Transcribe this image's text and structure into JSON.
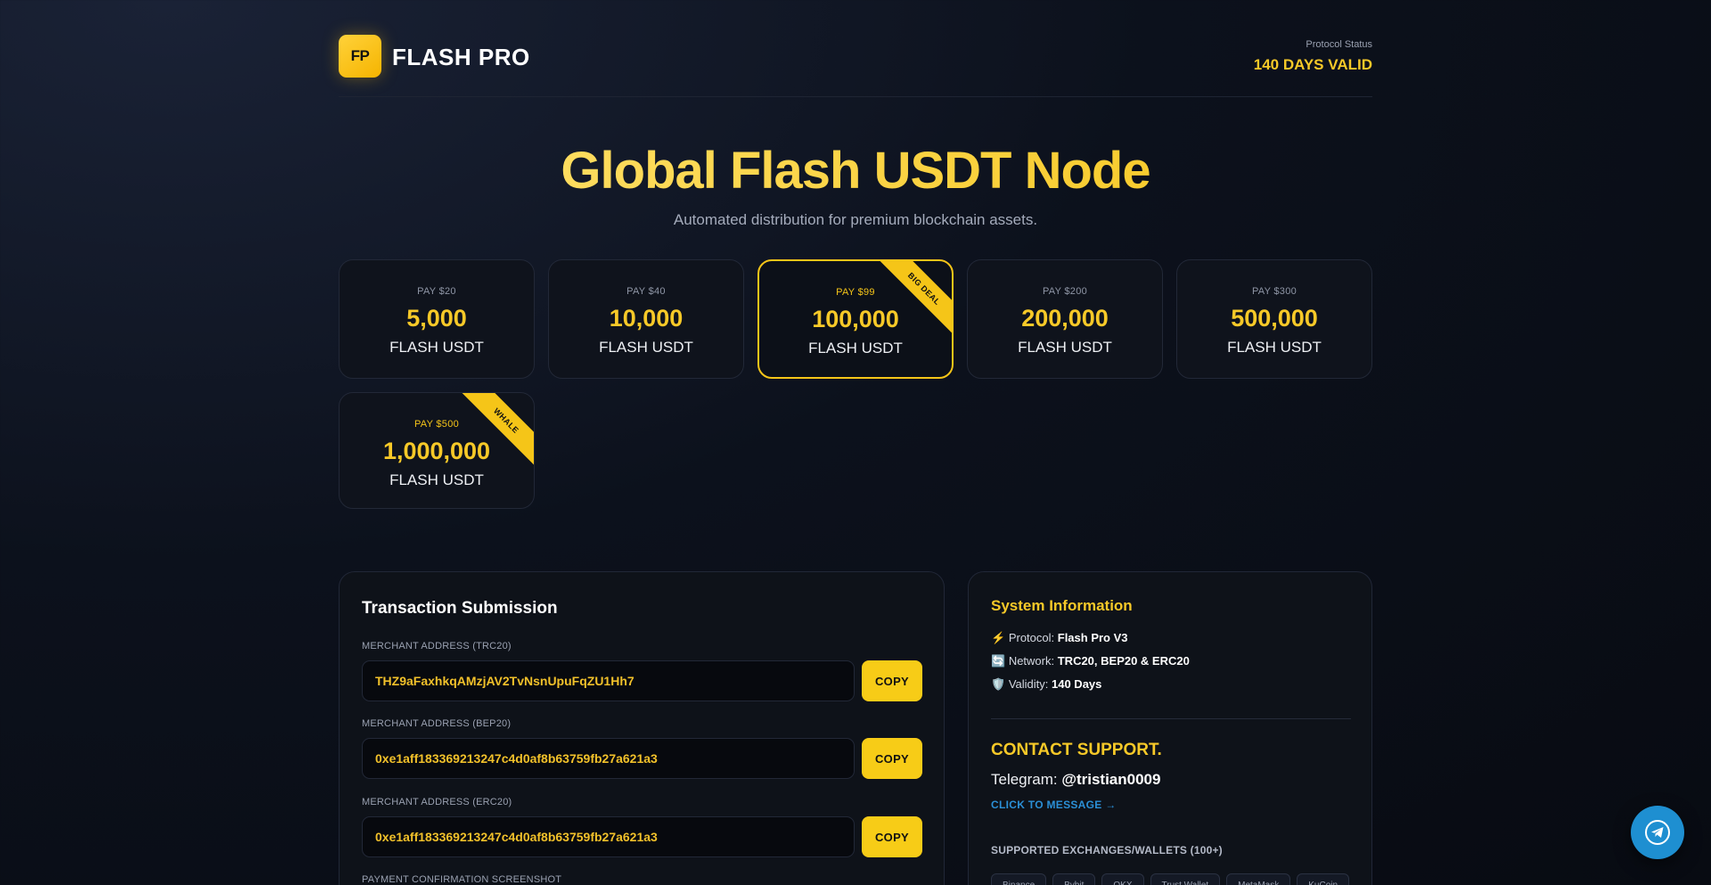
{
  "header": {
    "logo_text": "FP",
    "brand": "FLASH PRO",
    "status_label": "Protocol Status",
    "status_value": "140 DAYS VALID"
  },
  "hero": {
    "title": "Global Flash USDT Node",
    "subtitle": "Automated distribution for premium blockchain assets."
  },
  "packages": [
    {
      "pay": "PAY $20",
      "amount": "5,000",
      "unit": "FLASH USDT",
      "ribbon": ""
    },
    {
      "pay": "PAY $40",
      "amount": "10,000",
      "unit": "FLASH USDT",
      "ribbon": ""
    },
    {
      "pay": "PAY $99",
      "amount": "100,000",
      "unit": "FLASH USDT",
      "ribbon": "BIG DEAL"
    },
    {
      "pay": "PAY $200",
      "amount": "200,000",
      "unit": "FLASH USDT",
      "ribbon": ""
    },
    {
      "pay": "PAY $300",
      "amount": "500,000",
      "unit": "FLASH USDT",
      "ribbon": ""
    },
    {
      "pay": "PAY $500",
      "amount": "1,000,000",
      "unit": "FLASH USDT",
      "ribbon": "WHALE"
    }
  ],
  "transaction": {
    "title": "Transaction Submission",
    "addresses": [
      {
        "label": "MERCHANT ADDRESS (TRC20)",
        "value": "THZ9aFaxhkqAMzjAV2TvNsnUpuFqZU1Hh7",
        "button": "COPY"
      },
      {
        "label": "MERCHANT ADDRESS (BEP20)",
        "value": "0xe1aff183369213247c4d0af8b63759fb27a621a3",
        "button": "COPY"
      },
      {
        "label": "MERCHANT ADDRESS (ERC20)",
        "value": "0xe1aff183369213247c4d0af8b63759fb27a621a3",
        "button": "COPY"
      }
    ],
    "screenshot_label": "PAYMENT CONFIRMATION SCREENSHOT"
  },
  "system": {
    "title": "System Information",
    "rows": [
      {
        "icon": "⚡",
        "label": "Protocol:",
        "value": "Flash Pro V3"
      },
      {
        "icon": "🔄",
        "label": "Network:",
        "value": "TRC20, BEP20 & ERC20"
      },
      {
        "icon": "🛡️",
        "label": "Validity:",
        "value": "140 Days"
      }
    ],
    "contact_title": "CONTACT SUPPORT.",
    "telegram_label": "Telegram:",
    "telegram_handle": "@tristian0009",
    "click_message": "CLICK TO MESSAGE →",
    "supported_title": "SUPPORTED EXCHANGES/WALLETS (100+)",
    "exchanges": [
      "Binance",
      "Bybit",
      "OKX",
      "Trust Wallet",
      "MetaMask",
      "KuCoin"
    ]
  },
  "colors": {
    "accent": "#f7c928",
    "link": "#2b8fd6",
    "telegram": "#1e8fd1"
  }
}
